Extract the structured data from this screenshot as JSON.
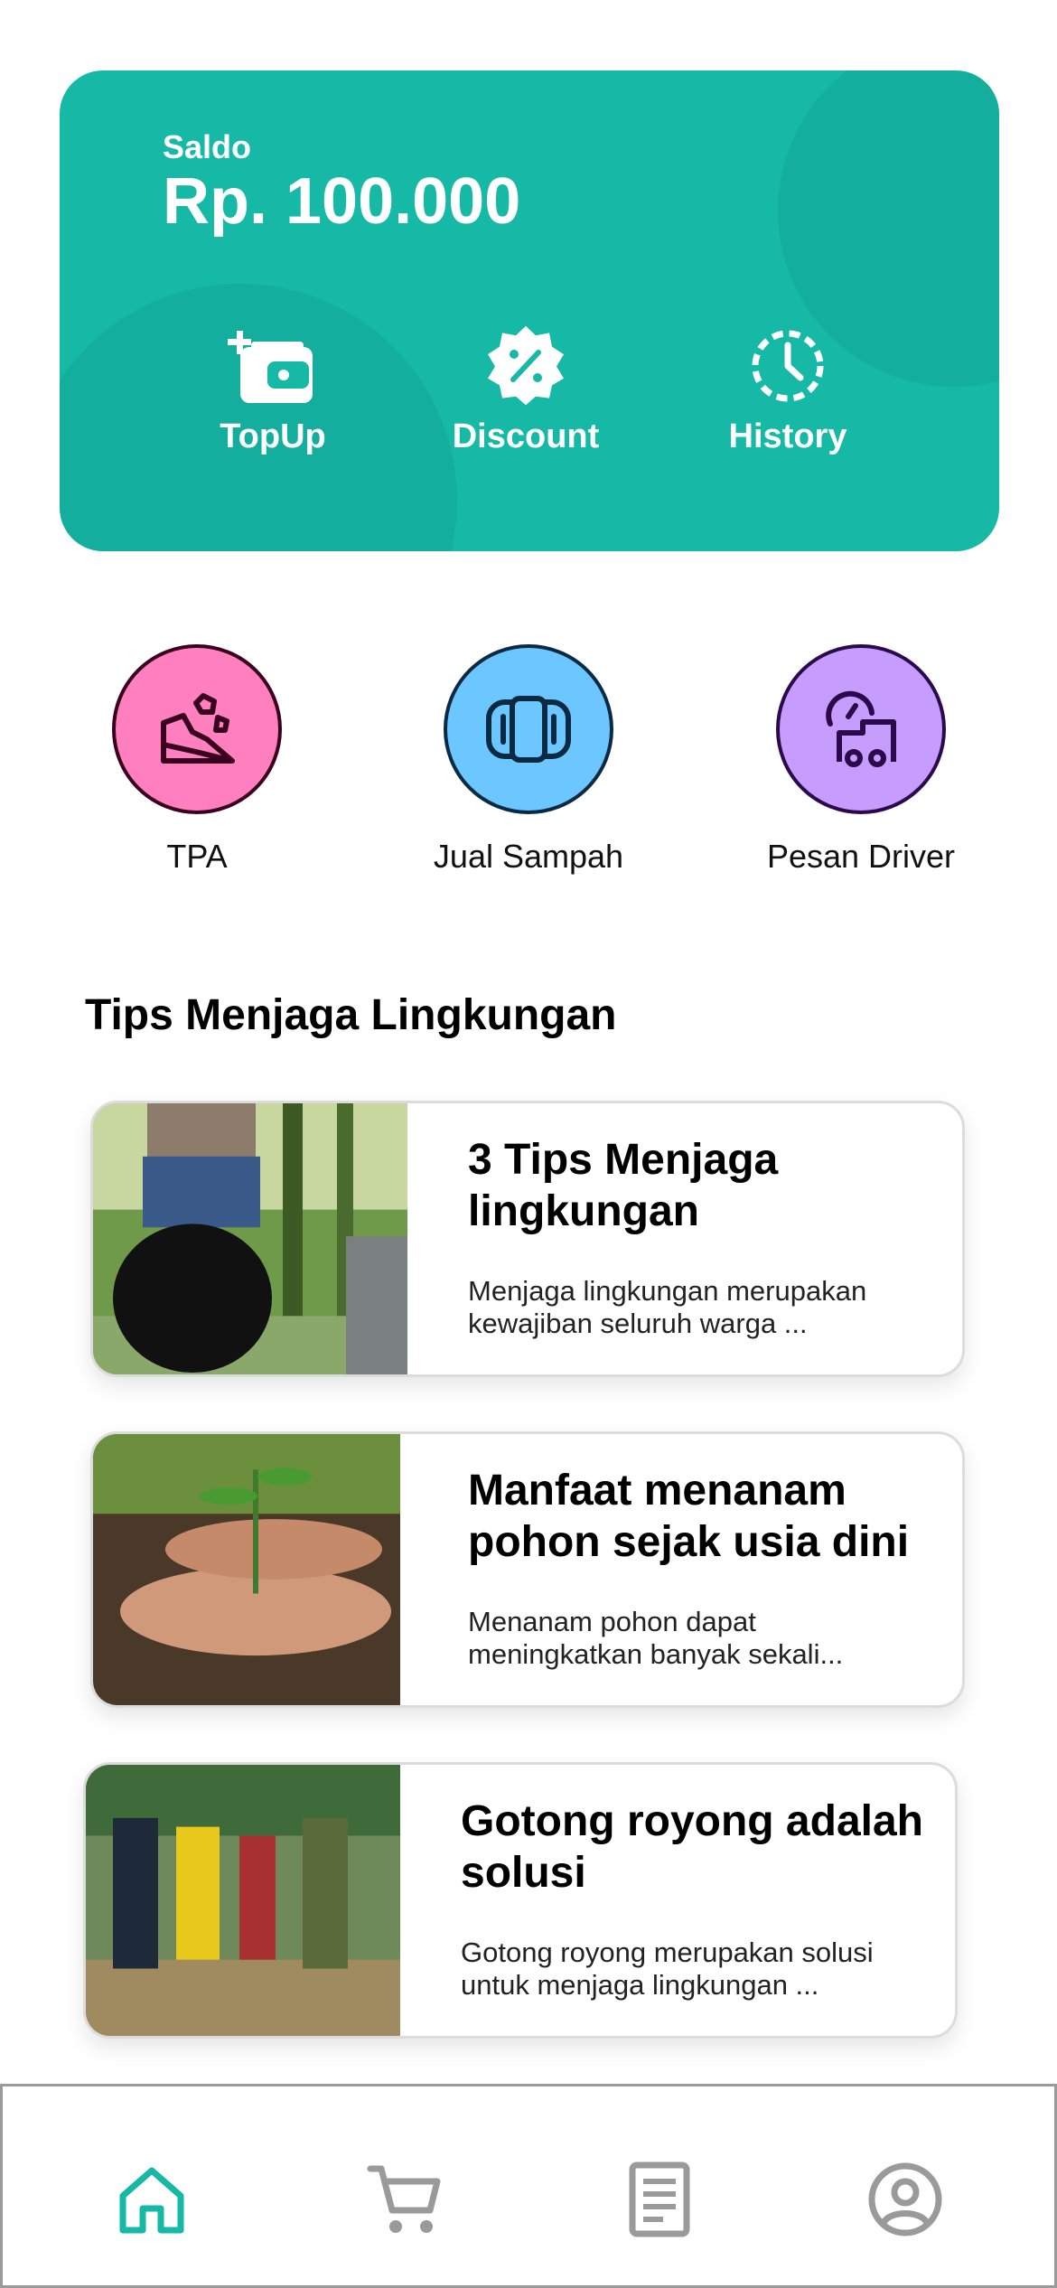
{
  "balance": {
    "label": "Saldo",
    "amount": "Rp. 100.000",
    "accent_color": "#16b8a6",
    "actions": [
      {
        "label": "TopUp",
        "icon": "wallet-plus-icon"
      },
      {
        "label": "Discount",
        "icon": "discount-badge-icon"
      },
      {
        "label": "History",
        "icon": "history-clock-icon"
      }
    ]
  },
  "services": [
    {
      "label": "TPA",
      "icon": "landfill-icon",
      "color": "#ff7fbf"
    },
    {
      "label": "Jual Sampah",
      "icon": "exchange-icon",
      "color": "#6cc6ff"
    },
    {
      "label": "Pesan Driver",
      "icon": "truck-icon",
      "color": "#c79cff"
    }
  ],
  "tips": {
    "title": "Tips Menjaga Lingkungan",
    "items": [
      {
        "title": "3 Tips Menjaga lingkungan",
        "desc": "Menjaga lingkungan merupakan kewajiban seluruh warga ..."
      },
      {
        "title": "Manfaat menanam pohon sejak usia dini",
        "desc": "Menanam pohon dapat meningkatkan banyak sekali..."
      },
      {
        "title": "Gotong royong adalah solusi",
        "desc": "Gotong royong merupakan solusi untuk menjaga lingkungan ..."
      }
    ]
  },
  "nav": {
    "items": [
      {
        "icon": "home-icon",
        "active": true
      },
      {
        "icon": "cart-icon",
        "active": false
      },
      {
        "icon": "document-icon",
        "active": false
      },
      {
        "icon": "profile-icon",
        "active": false
      }
    ],
    "active_color": "#16b8a6",
    "inactive_color": "#9a9a9a"
  }
}
